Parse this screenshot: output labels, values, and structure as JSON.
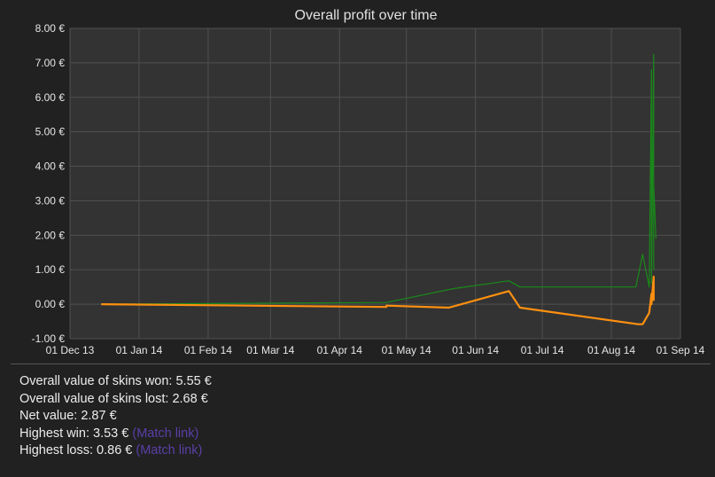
{
  "chart_data": {
    "type": "line",
    "title": "Overall profit over time",
    "xlabel": "",
    "ylabel": "",
    "x_ticks": [
      "01 Dec 13",
      "01 Jan 14",
      "01 Feb 14",
      "01 Mar 14",
      "01 Apr 14",
      "01 May 14",
      "01 Jun 14",
      "01 Jul 14",
      "01 Aug 14",
      "01 Sep 14"
    ],
    "x_range": [
      "2013-12-01",
      "2014-09-01"
    ],
    "y_ticks": [
      "8.00 €",
      "7.00 €",
      "6.00 €",
      "5.00 €",
      "4.00 €",
      "3.00 €",
      "2.00 €",
      "1.00 €",
      "0.00 €",
      "-1.00 €"
    ],
    "ylim": [
      -1,
      8
    ],
    "grid": true,
    "legend": "none",
    "series": [
      {
        "color": "#1a8a1a",
        "points": [
          [
            "2013-12-15",
            0.0
          ],
          [
            "2014-04-22",
            0.05
          ],
          [
            "2014-05-22",
            0.45
          ],
          [
            "2014-06-16",
            0.68
          ],
          [
            "2014-06-21",
            0.5
          ],
          [
            "2014-08-12",
            0.5
          ],
          [
            "2014-08-15",
            1.45
          ],
          [
            "2014-08-18",
            0.5
          ],
          [
            "2014-08-19",
            6.8
          ],
          [
            "2014-08-19",
            0.6
          ],
          [
            "2014-08-20",
            7.25
          ],
          [
            "2014-08-20",
            1.0
          ],
          [
            "2014-08-20",
            3.5
          ],
          [
            "2014-08-21",
            1.9
          ]
        ]
      },
      {
        "color": "#ff9010",
        "points": [
          [
            "2013-12-15",
            0.0
          ],
          [
            "2014-04-22",
            -0.08
          ],
          [
            "2014-04-22",
            -0.04
          ],
          [
            "2014-05-20",
            -0.1
          ],
          [
            "2014-06-16",
            0.38
          ],
          [
            "2014-06-21",
            -0.1
          ],
          [
            "2014-08-13",
            -0.58
          ],
          [
            "2014-08-15",
            -0.58
          ],
          [
            "2014-08-18",
            -0.25
          ],
          [
            "2014-08-19",
            0.3
          ],
          [
            "2014-08-19",
            0.0
          ],
          [
            "2014-08-20",
            0.8
          ],
          [
            "2014-08-20",
            0.1
          ]
        ]
      }
    ]
  },
  "stats": {
    "won_label": "Overall value of skins won: 5.55 €",
    "lost_label": "Overall value of skins lost: 2.68 €",
    "net_label": "Net value: 2.87 €",
    "highest_win_label": "Highest win: 3.53 €",
    "highest_loss_label": "Highest loss: 0.86 €",
    "match_link_label": "(Match link)"
  },
  "colors": {
    "plot_background": "#333333",
    "page_background": "#212121",
    "link": "#5a3fa8"
  }
}
